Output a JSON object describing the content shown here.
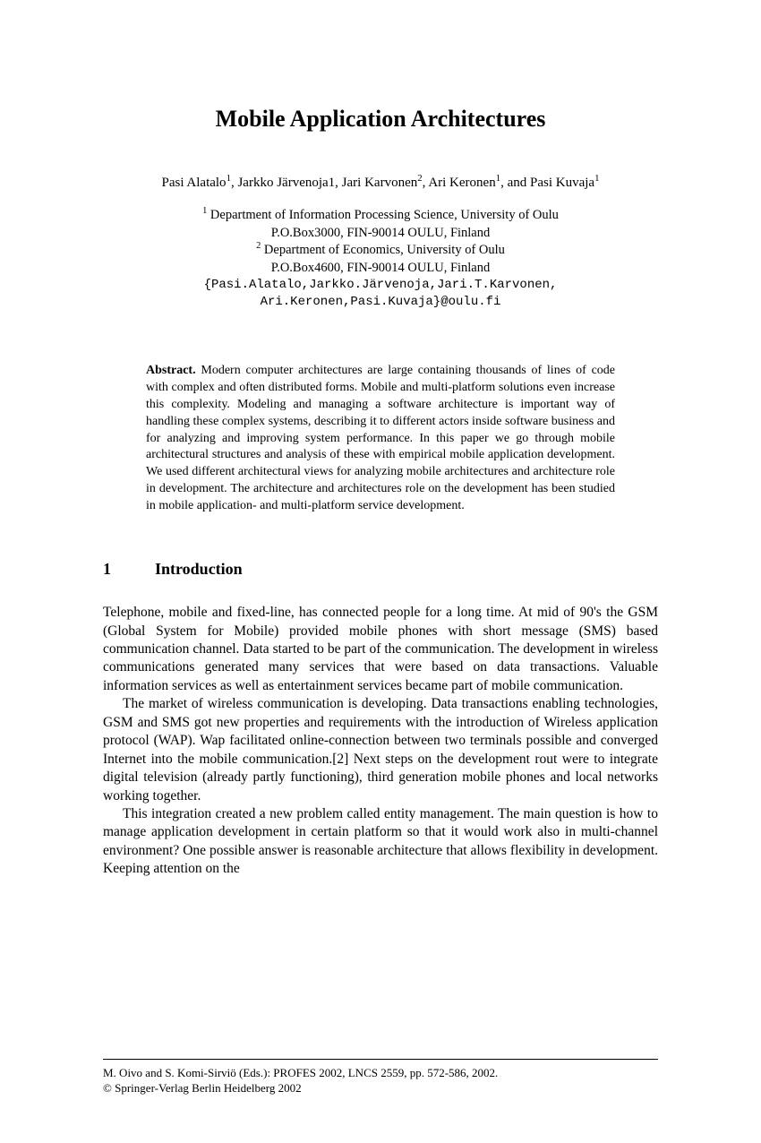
{
  "title": "Mobile Application Architectures",
  "authors_html": "Pasi Alatalo<sup>1</sup>, Jarkko Järvenoja1, Jari Karvonen<sup>2</sup>, Ari Keronen<sup>1</sup>, and Pasi Kuvaja<sup>1</sup>",
  "affil1_html": "<sup>1</sup> Department of Information Processing Science, University of Oulu",
  "affil1b": "P.O.Box3000, FIN-90014 OULU, Finland",
  "affil2_html": "<sup>2</sup> Department of Economics, University of Oulu",
  "affil2b": "P.O.Box4600, FIN-90014 OULU, Finland",
  "emails1": "{Pasi.Alatalo,Jarkko.Järvenoja,Jari.T.Karvonen,",
  "emails2": "Ari.Keronen,Pasi.Kuvaja}@oulu.fi",
  "abstract_label": "Abstract.",
  "abstract_text": "Modern computer architectures are large containing thousands of lines of code with complex and often distributed forms. Mobile and multi-platform solutions even increase this complexity. Modeling and managing a software architecture is important way of handling these complex systems, describing it to different actors inside software business and for analyzing and improving system performance. In this paper we go through mobile architectural structures and analysis of these with empirical mobile application development. We used different architectural views for analyzing mobile architectures and architecture role in development. The architecture and architectures role on the development has been studied in mobile application- and multi-platform service development.",
  "section": {
    "num": "1",
    "title": "Introduction"
  },
  "para1": "Telephone, mobile and fixed-line, has connected people for a long time. At mid of 90's the GSM (Global System for Mobile) provided mobile phones with short message (SMS) based communication channel. Data started to be part of the communication. The development in wireless communications generated many services that were based on data transactions. Valuable information services as well as entertainment services became part of mobile communication.",
  "para2": "The market of wireless communication is developing. Data transactions enabling technologies, GSM and SMS got new properties and requirements with the introduction of Wireless application protocol (WAP). Wap facilitated online-connection between two terminals possible and converged Internet into the mobile communication.[2] Next steps on the development rout were to integrate digital television (already partly functioning), third generation mobile phones and local networks working together.",
  "para3": "This integration created a new problem called entity management. The main question is how to manage application development in certain platform so that it would work also in multi-channel environment? One possible answer is reasonable architecture that allows flexibility in development. Keeping attention on the",
  "footer1": "M. Oivo and S. Komi-Sirviö (Eds.): PROFES 2002, LNCS 2559, pp. 572-586, 2002.",
  "footer2": "© Springer-Verlag Berlin Heidelberg 2002"
}
